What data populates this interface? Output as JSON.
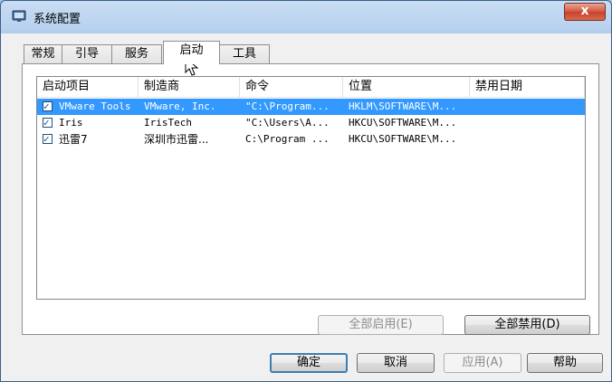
{
  "window": {
    "title": "系统配置",
    "close_glyph": "x"
  },
  "tabs": [
    {
      "label": "常规"
    },
    {
      "label": "引导"
    },
    {
      "label": "服务"
    },
    {
      "label": "启动"
    },
    {
      "label": "工具"
    }
  ],
  "active_tab": "启动",
  "startup_list": {
    "columns": [
      "启动项目",
      "制造商",
      "命令",
      "位置",
      "禁用日期"
    ],
    "rows": [
      {
        "checked": true,
        "name": "VMware Tools",
        "manufacturer": "VMware, Inc.",
        "command": "\"C:\\Program...",
        "location": "HKLM\\SOFTWARE\\M...",
        "disabled_date": "",
        "selected": true
      },
      {
        "checked": true,
        "name": "Iris",
        "manufacturer": "IrisTech",
        "command": "\"C:\\Users\\A...",
        "location": "HKCU\\SOFTWARE\\M...",
        "disabled_date": "",
        "selected": false
      },
      {
        "checked": true,
        "name": "迅雷7",
        "manufacturer": "深圳市迅雷...",
        "command": "C:\\Program ...",
        "location": "HKCU\\SOFTWARE\\M...",
        "disabled_date": "",
        "selected": false
      }
    ]
  },
  "panel_buttons": {
    "enable_all": "全部启用(E)",
    "disable_all": "全部禁用(D)"
  },
  "dialog_buttons": {
    "ok": "确定",
    "cancel": "取消",
    "apply": "应用(A)",
    "help": "帮助"
  },
  "colors": {
    "selection": "#3399ff",
    "titlebar": "#b9d2ef"
  }
}
